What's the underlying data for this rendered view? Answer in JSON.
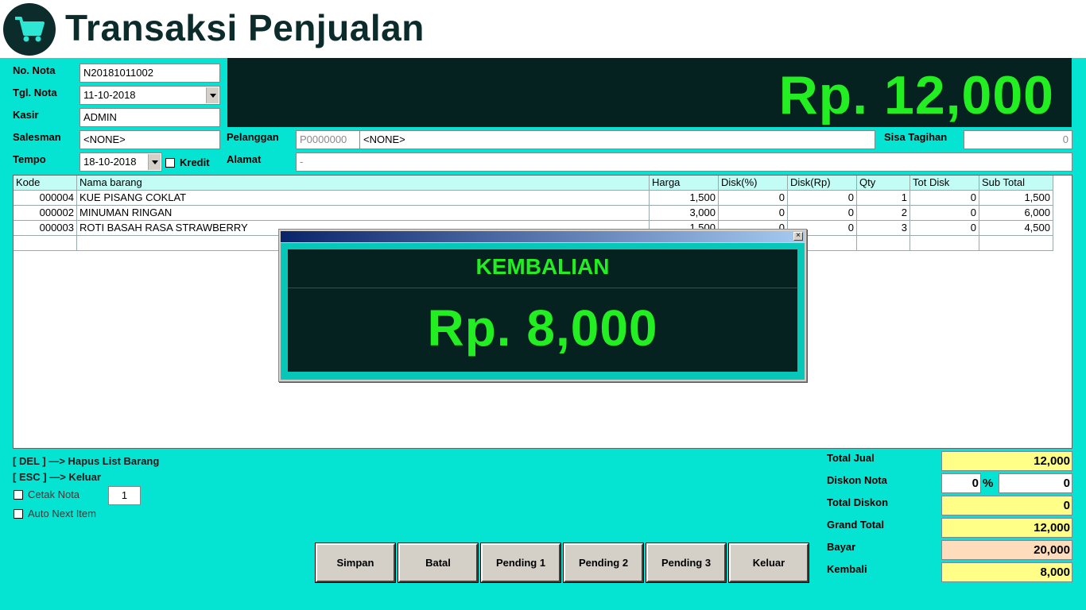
{
  "header": {
    "title": "Transaksi Penjualan",
    "icon": "cart-icon"
  },
  "form": {
    "no_nota_label": "No. Nota",
    "no_nota": "N20181011002",
    "tgl_nota_label": "Tgl. Nota",
    "tgl_nota": "11-10-2018",
    "kasir_label": "Kasir",
    "kasir": "ADMIN",
    "salesman_label": "Salesman",
    "salesman": "<NONE>",
    "tempo_label": "Tempo",
    "tempo": "18-10-2018",
    "kredit_label": "Kredit",
    "pelanggan_label": "Pelanggan",
    "pelanggan_kode": "P0000000",
    "pelanggan_nama": "<NONE>",
    "alamat_label": "Alamat",
    "alamat": "-",
    "sisa_tagihan_label": "Sisa Tagihan",
    "sisa_tagihan": "0"
  },
  "total_display": "Rp. 12,000",
  "grid": {
    "columns": [
      "Kode",
      "Nama barang",
      "Harga",
      "Disk(%)",
      "Disk(Rp)",
      "Qty",
      "Tot Disk",
      "Sub Total"
    ],
    "rows": [
      [
        "000004",
        "KUE PISANG COKLAT",
        "1,500",
        "0",
        "0",
        "1",
        "0",
        "1,500"
      ],
      [
        "000002",
        "MINUMAN RINGAN",
        "3,000",
        "0",
        "0",
        "2",
        "0",
        "6,000"
      ],
      [
        "000003",
        "ROTI BASAH RASA STRAWBERRY",
        "1,500",
        "0",
        "0",
        "3",
        "0",
        "4,500"
      ]
    ]
  },
  "popup": {
    "label": "KEMBALIAN",
    "value": "Rp. 8,000",
    "close_glyph": "×"
  },
  "hints": {
    "del": "[ DEL ] —> Hapus List Barang",
    "esc": "[ ESC ] —> Keluar"
  },
  "options": {
    "cetak_nota_label": "Cetak Nota",
    "cetak_qty": "1",
    "auto_next_label": "Auto Next Item"
  },
  "summary": {
    "total_jual_label": "Total Jual",
    "total_jual": "12,000",
    "diskon_nota_label": "Diskon Nota",
    "diskon_pct": "0",
    "pct_sign": "%",
    "diskon_rp": "0",
    "total_diskon_label": "Total Diskon",
    "total_diskon": "0",
    "grand_total_label": "Grand Total",
    "grand_total": "12,000",
    "bayar_label": "Bayar",
    "bayar": "20,000",
    "kembali_label": "Kembali",
    "kembali": "8,000"
  },
  "buttons": {
    "simpan": "Simpan",
    "batal": "Batal",
    "pending1": "Pending 1",
    "pending2": "Pending 2",
    "pending3": "Pending 3",
    "keluar": "Keluar"
  },
  "colors": {
    "bg": "#05e3d2",
    "panel": "#052221",
    "accent_green": "#23ee21",
    "yellow": "#ffff88",
    "peach": "#ffdcbc"
  }
}
